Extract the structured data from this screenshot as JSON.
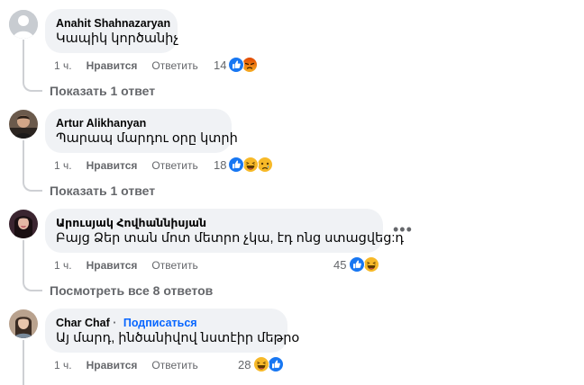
{
  "comments": [
    {
      "author": "Anahit Shahnazaryan",
      "text": "Կապիկ կործանիչ",
      "time": "1 ч.",
      "like_label": "Нравится",
      "reply_label": "Ответить",
      "reaction_count": "14",
      "reactions": [
        "like-icon",
        "angry-icon"
      ],
      "replies_link": "Показать 1 ответ"
    },
    {
      "author": "Artur Alikhanyan",
      "text": "Պարապ մարդու օրը կտրի",
      "time": "1 ч.",
      "like_label": "Нравится",
      "reply_label": "Ответить",
      "reaction_count": "18",
      "reactions": [
        "like-icon",
        "haha-icon",
        "sad-icon"
      ],
      "replies_link": "Показать 1 ответ"
    },
    {
      "author": "Արուսյակ Հովհաննիսյան",
      "text": "Բայց Ձեր տան մոտ մետրո չկա, էդ ոնց ստացվեց:դ",
      "time": "1 ч.",
      "like_label": "Нравится",
      "reply_label": "Ответить",
      "reaction_count": "45",
      "reactions": [
        "like-icon",
        "haha-icon"
      ],
      "replies_link": "Посмотреть все 8 ответов",
      "more_icon": "more-options-icon"
    },
    {
      "author": "Char Chaf",
      "follow_label": "Подписаться",
      "text": "Այ մարդ, ինծանիվով նստէիր մեթրօ",
      "time": "1 ч.",
      "like_label": "Нравится",
      "reply_label": "Ответить",
      "reaction_count": "28",
      "reactions": [
        "haha-icon",
        "like-icon"
      ]
    }
  ],
  "colors": {
    "bubble": "#f0f2f5",
    "like_blue": "#1877f2",
    "angry_red": "#e9710f",
    "haha_yellow": "#f7b928",
    "link_blue": "#0866ff",
    "muted": "#65676b"
  }
}
